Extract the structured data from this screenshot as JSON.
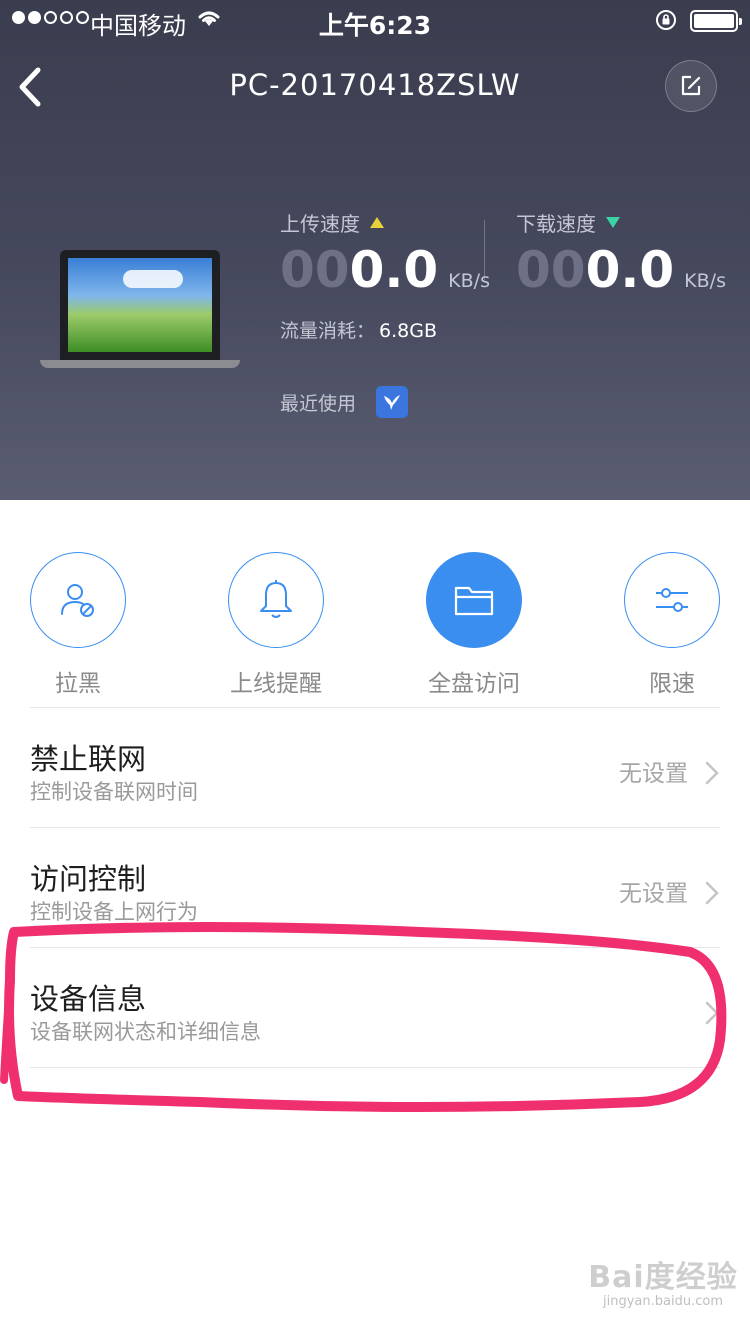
{
  "status_bar": {
    "carrier": "中国移动",
    "time": "上午6:23"
  },
  "header": {
    "device_name": "PC-20170418ZSLW"
  },
  "device": {
    "upload": {
      "label": "上传速度",
      "dim": "00",
      "bright": "0.0",
      "unit": "KB/s"
    },
    "download": {
      "label": "下载速度",
      "dim": "00",
      "bright": "0.0",
      "unit": "KB/s"
    },
    "traffic_label": "流量消耗：",
    "traffic_value": "6.8GB",
    "recent_label": "最近使用",
    "colors": {
      "upload_arrow": "#e9d23a",
      "download_arrow": "#3bd4a4"
    }
  },
  "actions": [
    {
      "label": "拉黑",
      "icon": "user-block-icon",
      "active": false
    },
    {
      "label": "上线提醒",
      "icon": "bell-icon",
      "active": false
    },
    {
      "label": "全盘访问",
      "icon": "folder-icon",
      "active": true
    },
    {
      "label": "限速",
      "icon": "sliders-icon",
      "active": false
    }
  ],
  "rows": [
    {
      "title": "禁止联网",
      "subtitle": "控制设备联网时间",
      "value": "无设置"
    },
    {
      "title": "访问控制",
      "subtitle": "控制设备上网行为",
      "value": "无设置"
    },
    {
      "title": "设备信息",
      "subtitle": "设备联网状态和详细信息",
      "value": ""
    }
  ],
  "watermark": {
    "logo": "Bai度经验",
    "url": "jingyan.baidu.com"
  },
  "accent_color": "#3a8ef0",
  "annotation_color": "#f0306e"
}
